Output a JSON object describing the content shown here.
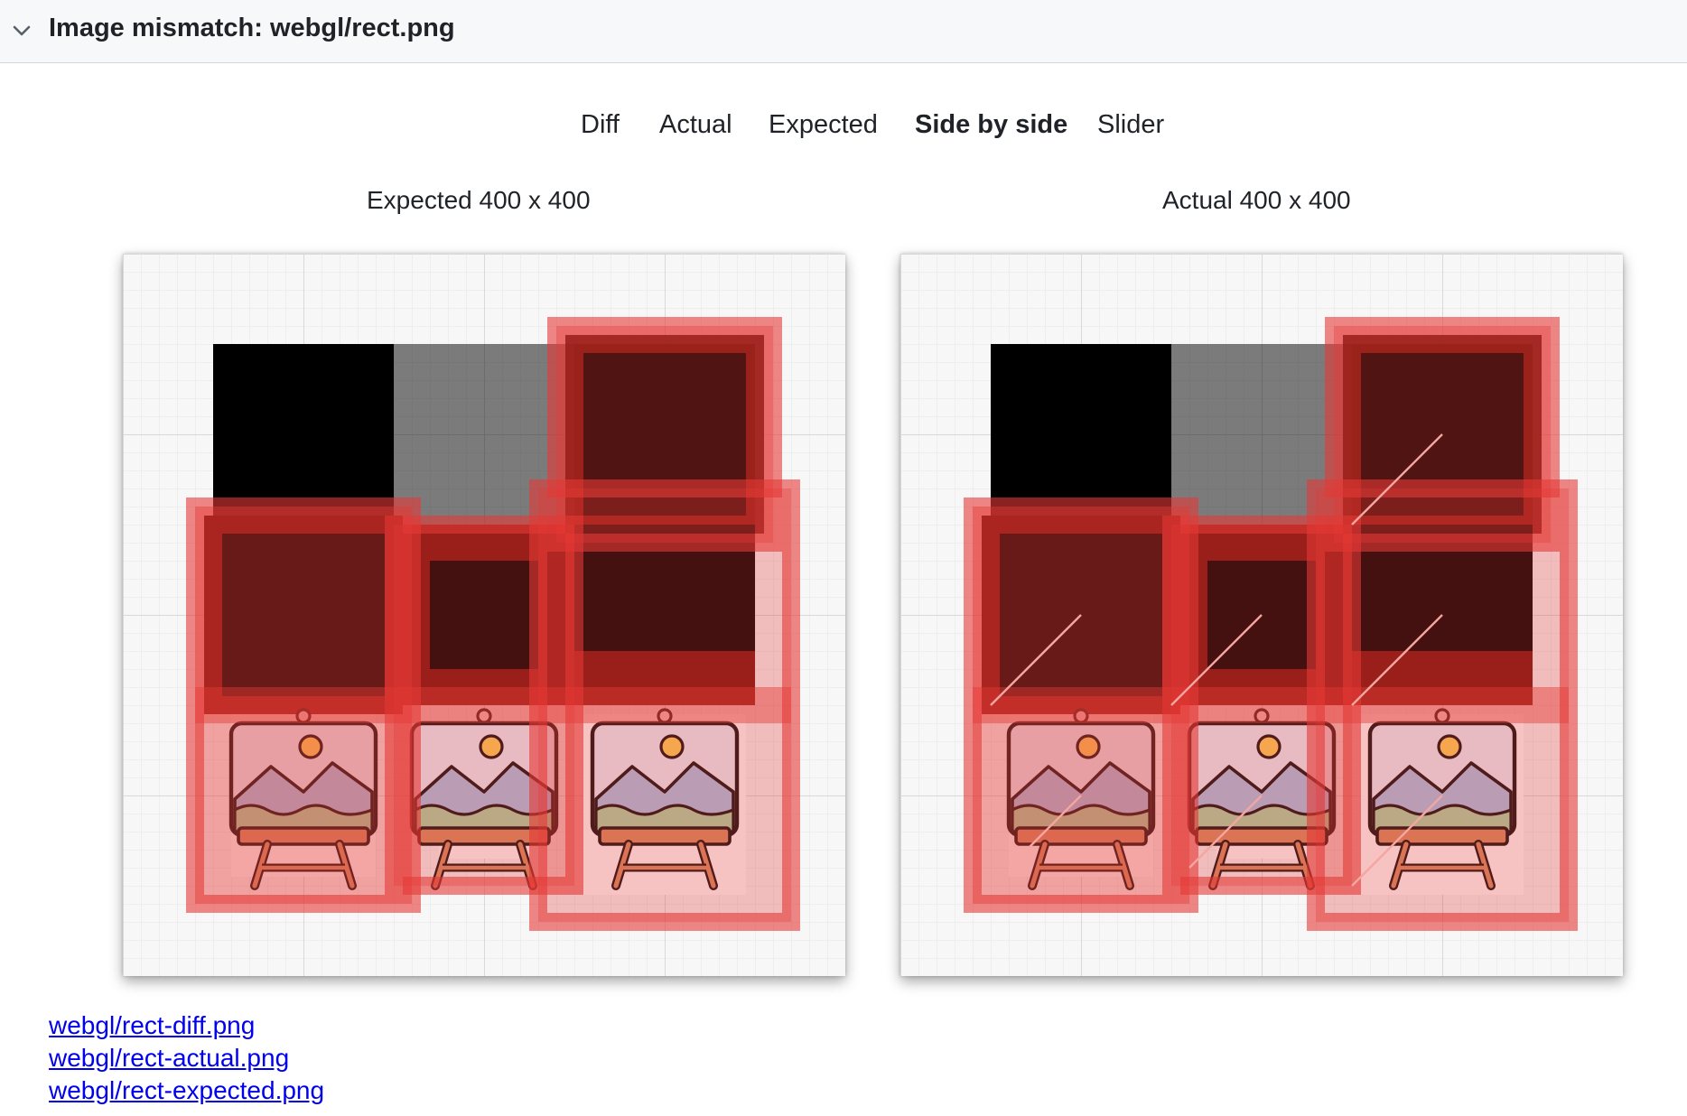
{
  "header": {
    "title": "Image mismatch: webgl/rect.png",
    "collapse_icon": "chevron-down-icon"
  },
  "tabs": [
    {
      "label": "Diff",
      "active": false
    },
    {
      "label": "Actual",
      "active": false
    },
    {
      "label": "Expected",
      "active": false
    },
    {
      "label": "Side by side",
      "active": true
    },
    {
      "label": "Slider",
      "active": false
    }
  ],
  "side_by_side": {
    "expected": {
      "label": "Expected",
      "size": "400 x 400"
    },
    "actual": {
      "label": "Actual",
      "size": "400 x 400"
    }
  },
  "links": [
    {
      "text": "webgl/rect-diff.png"
    },
    {
      "text": "webgl/rect-actual.png"
    },
    {
      "text": "webgl/rect-expected.png"
    }
  ],
  "colors": {
    "diff_red": "#e53935",
    "link": "#0000ee",
    "header_bg": "#f6f8fa"
  }
}
